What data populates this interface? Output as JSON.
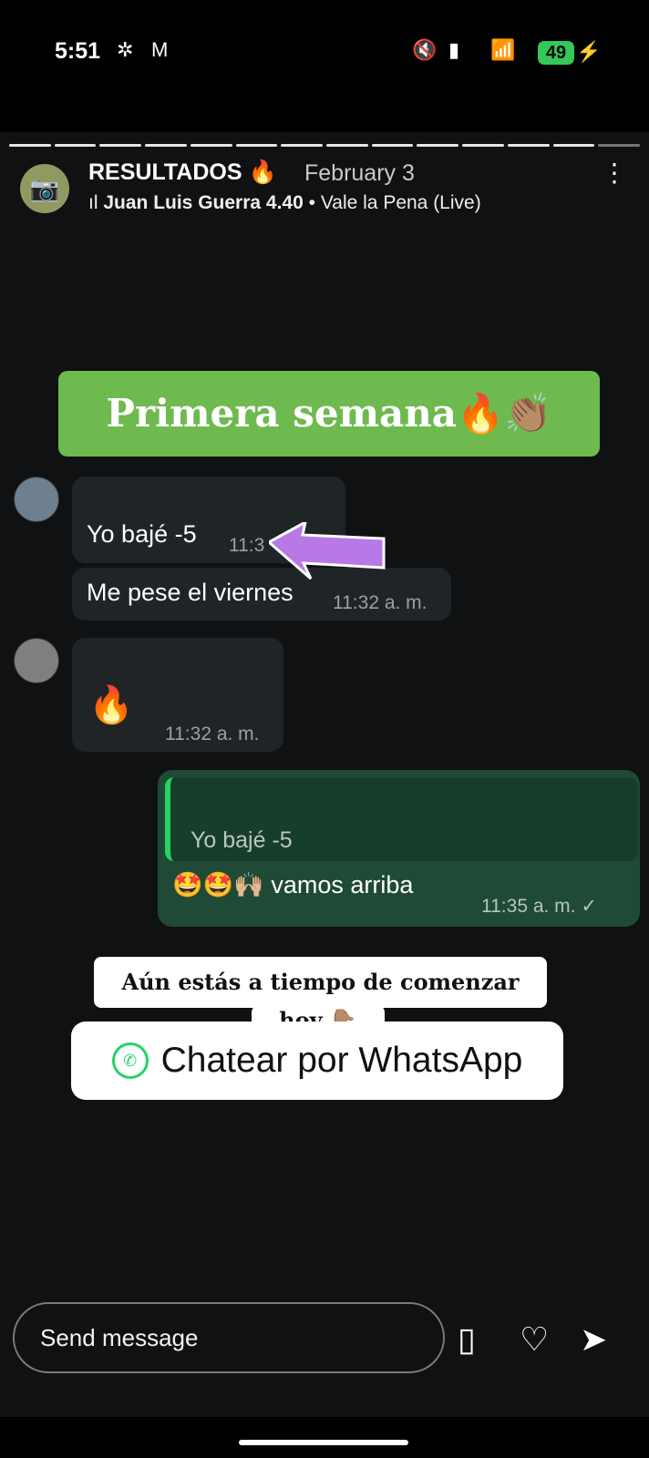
{
  "status": {
    "time": "5:51",
    "battery": "49",
    "icons": [
      "slack-icon",
      "gmail-icon",
      "mute-icon",
      "signal-icon",
      "wifi-icon",
      "battery-icon"
    ]
  },
  "story": {
    "account": "RESULTADOS 🔥",
    "date": "February 3",
    "music_artist": "Juan Luis Guerra 4.40",
    "music_separator": "•",
    "music_song": "Vale la Pena (Live)",
    "headline": "Primera semana🔥👏🏽",
    "messages_left": [
      {
        "text": "Yo bajé -5",
        "time": "11:3"
      },
      {
        "text": "Me pese el viernes",
        "time": "11:32 a. m."
      },
      {
        "text": "🔥",
        "time": "11:32 a. m."
      }
    ],
    "reply": {
      "quote": "Yo bajé -5",
      "text": "🤩🤩🙌🏼 vamos arriba",
      "time": "11:35 a. m. ✓"
    },
    "cta_line1": "Aún estás a tiempo de comenzar",
    "cta_line2": "hoy 👇🏽",
    "cta_button": "Chatear por WhatsApp"
  },
  "bottom": {
    "placeholder": "Send message",
    "icons": [
      "device-icon",
      "heart-icon",
      "send-icon"
    ]
  },
  "colors": {
    "headline_bg": "#6fba4f",
    "whatsapp": "#25d366",
    "bubble_dark": "#1f2427",
    "bubble_green": "#1f4a36"
  }
}
